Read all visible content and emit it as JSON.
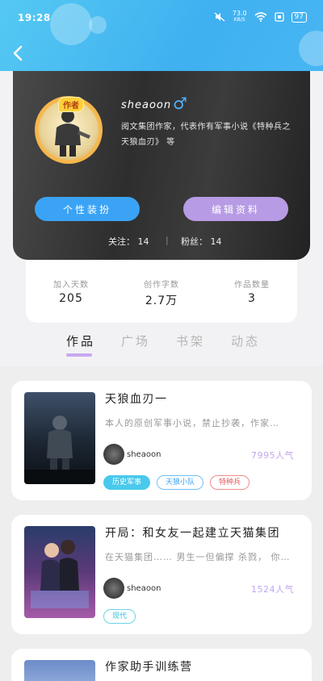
{
  "status_bar": {
    "time": "19:28",
    "speed_value": "73.0",
    "speed_unit": "KB/S",
    "battery": "97"
  },
  "profile": {
    "author_badge": "作者",
    "name": "sheaoon",
    "gender_symbol": "♂",
    "bio": "阅文集团作家，代表作有军事小说《特种兵之天狼血刃》 等",
    "buttons": {
      "decorate": "个性装扮",
      "edit": "编辑资料"
    },
    "follow_text": "关注： 14",
    "separator": "|",
    "fans_text": "粉丝： 14"
  },
  "stats": [
    {
      "label": "加入天数",
      "value": "205"
    },
    {
      "label": "创作字数",
      "value": "2.7万"
    },
    {
      "label": "作品数量",
      "value": "3"
    }
  ],
  "tabs": [
    "作品",
    "广场",
    "书架",
    "动态"
  ],
  "works": [
    {
      "title": "天狼血刃一",
      "desc": "本人的原创军事小说，禁止抄袭，作家…",
      "author": "sheaoon",
      "popularity": "7995人气",
      "tags": [
        "历史军事",
        "天狼小队",
        "特种兵"
      ]
    },
    {
      "title": "开局：和女友一起建立天猫集团",
      "desc": "在天猫集团……  男生一但偏撑 杀戮， 你…",
      "author": "sheaoon",
      "popularity": "1524人气",
      "tags": [
        "现代"
      ]
    },
    {
      "title": "作家助手训练营"
    }
  ]
}
